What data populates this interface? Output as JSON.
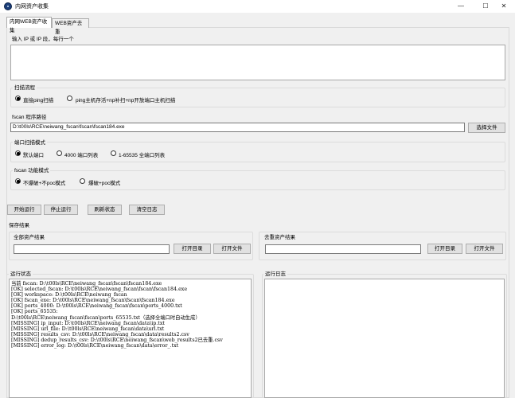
{
  "window": {
    "title": "内网资产收集",
    "minimize": "—",
    "maximize": "☐",
    "close": "✕"
  },
  "tabs": [
    {
      "label": "内网WEB资产收集"
    },
    {
      "label": "WEB资产去重"
    }
  ],
  "ip_input": {
    "label": "输入 IP 或 IP 段，每行一个",
    "value": ""
  },
  "scan_flow": {
    "title": "扫描流程",
    "options": [
      {
        "label": "直接ping扫描",
        "checked": true
      },
      {
        "label": "ping主机存活+np补扫+np开放端口主机扫描",
        "checked": false
      }
    ]
  },
  "fscan_path": {
    "label": "fscan 程序路径",
    "value": "D:\\t00ls\\RCE\\neiwang_fscan\\fscan\\fscan184.exe",
    "browse_button": "选择文件"
  },
  "port_mode": {
    "title": "端口扫描模式",
    "options": [
      {
        "label": "默认端口",
        "checked": true
      },
      {
        "label": "4000 端口列表",
        "checked": false
      },
      {
        "label": "1-65535 全端口列表",
        "checked": false
      }
    ]
  },
  "fscan_mode": {
    "title": "fscan 功能模式",
    "options": [
      {
        "label": "不爆破+不poc模式",
        "checked": true
      },
      {
        "label": "爆破+poc模式",
        "checked": false
      }
    ]
  },
  "actions": {
    "start": "开始运行",
    "stop": "停止运行",
    "refresh": "刷新状态",
    "clear": "清空日志"
  },
  "save_results": {
    "title": "保存结果",
    "all_assets": {
      "title": "全部资产结果",
      "value": "",
      "open_dir": "打开目录",
      "open_file": "打开文件"
    },
    "dedup_assets": {
      "title": "去重资产结果",
      "value": "",
      "open_dir": "打开目录",
      "open_file": "打开文件"
    }
  },
  "status": {
    "title": "运行状态",
    "lines": [
      "当前 fscan: D:\\t00ls\\RCE\\neiwang_fscan\\fscan\\fscan184.exe",
      "[OK] selected_fscan: D:\\t00ls\\RCE\\neiwang_fscan\\fscan\\fscan184.exe",
      "[OK] workspace: D:\\t00ls\\RCE\\neiwang_fscan",
      "[OK] fscan_exe: D:\\t00ls\\RCE\\neiwang_fscan\\fscan\\fscan184.exe",
      "[OK] ports_4000: D:\\t00ls\\RCE\\neiwang_fscan\\fscan\\ports_4000.txt",
      "[OK] ports_65535:",
      "D:\\t00ls\\RCE\\neiwang_fscan\\fscan\\ports_65535.txt（选择全端口时自动生成）",
      "[MISSING] ip_input: D:\\t00ls\\RCE\\neiwang_fscan\\data\\ip.txt",
      "[MISSING] url_file: D:\\t00ls\\RCE\\neiwang_fscan\\data\\url.txt",
      "[MISSING] results_csv: D:\\t00ls\\RCE\\neiwang_fscan\\data\\results2.csv",
      "[MISSING] dedup_results_csv: D:\\t00ls\\RCE\\neiwang_fscan\\web_results2已去重.csv",
      "[MISSING] error_log: D:\\t00ls\\RCE\\neiwang_fscan\\data\\error_.txt"
    ]
  },
  "run_log": {
    "title": "运行日志",
    "lines": []
  }
}
